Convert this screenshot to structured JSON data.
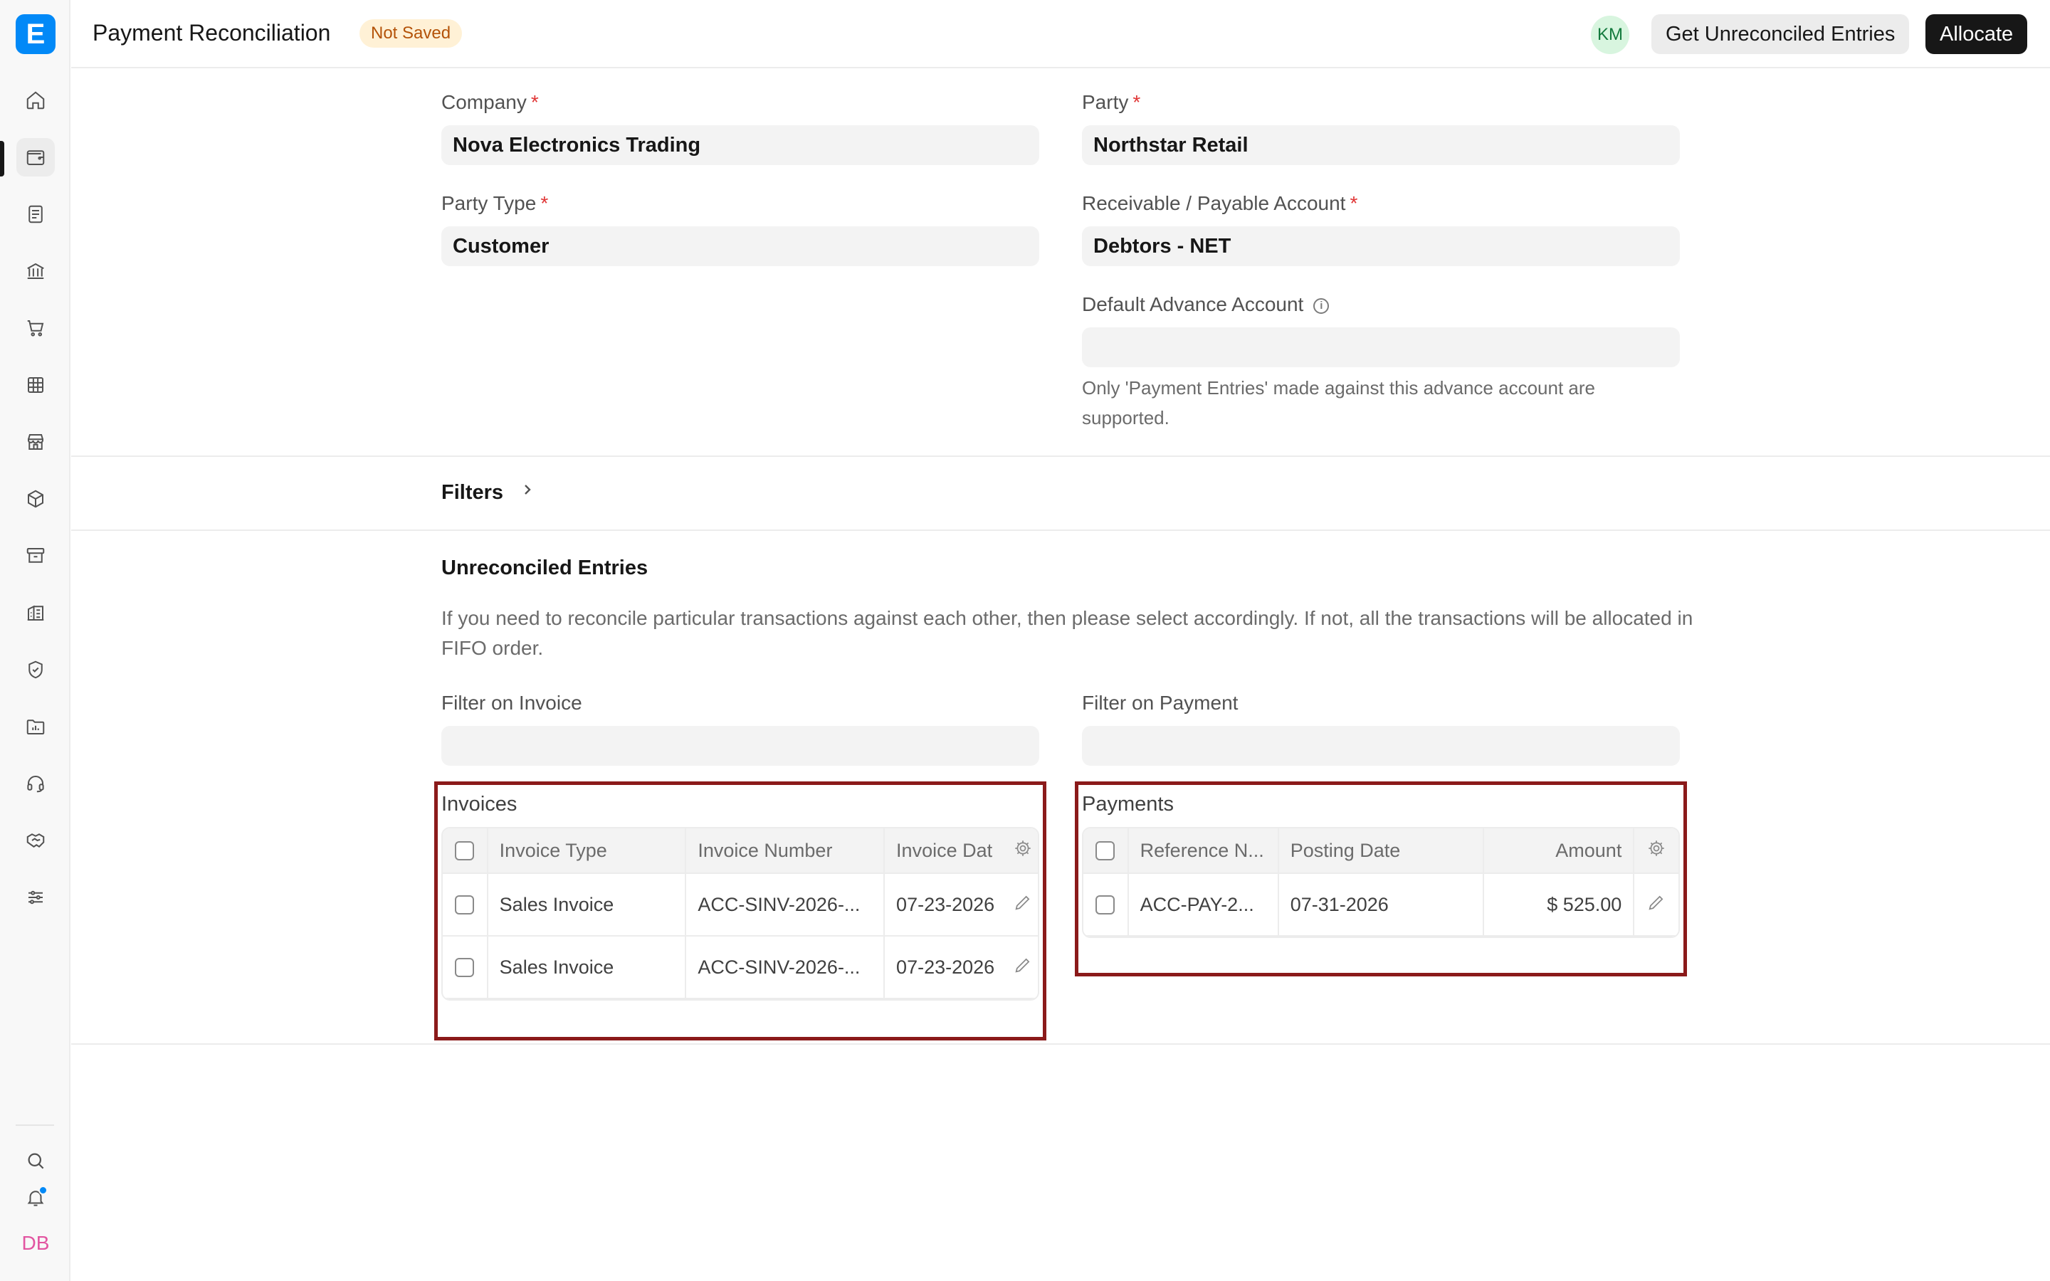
{
  "app": {
    "logo_letter": "E",
    "user_initials": "DB"
  },
  "header": {
    "title": "Payment Reconciliation",
    "status": "Not Saved",
    "user_avatar": "KM",
    "get_entries_label": "Get Unreconciled Entries",
    "allocate_label": "Allocate"
  },
  "sidebar": {
    "items": [
      {
        "name": "home-icon"
      },
      {
        "name": "wallet-icon",
        "active": true
      },
      {
        "name": "document-icon"
      },
      {
        "name": "bank-icon"
      },
      {
        "name": "cart-icon"
      },
      {
        "name": "table-icon"
      },
      {
        "name": "store-icon"
      },
      {
        "name": "box-icon"
      },
      {
        "name": "archive-icon"
      },
      {
        "name": "building-icon"
      },
      {
        "name": "shield-icon"
      },
      {
        "name": "folder-chart-icon"
      },
      {
        "name": "headset-icon"
      },
      {
        "name": "handshake-icon"
      },
      {
        "name": "sliders-icon"
      }
    ],
    "bottom": [
      "search-icon",
      "bell-icon"
    ]
  },
  "form": {
    "company": {
      "label": "Company",
      "value": "Nova Electronics Trading"
    },
    "party": {
      "label": "Party",
      "value": "Northstar Retail"
    },
    "party_type": {
      "label": "Party Type",
      "value": "Customer"
    },
    "receivable_account": {
      "label": "Receivable / Payable Account",
      "value": "Debtors - NET"
    },
    "default_advance_account": {
      "label": "Default Advance Account",
      "value": "",
      "help": "Only 'Payment Entries' made against this advance account are supported."
    }
  },
  "filters": {
    "label": "Filters"
  },
  "unreconciled": {
    "title": "Unreconciled Entries",
    "description": "If you need to reconcile particular transactions against each other, then please select accordingly. If not, all the transactions will be allocated in FIFO order.",
    "filter_invoice": {
      "label": "Filter on Invoice",
      "value": ""
    },
    "filter_payment": {
      "label": "Filter on Payment",
      "value": ""
    }
  },
  "invoices": {
    "title": "Invoices",
    "columns": [
      "Invoice Type",
      "Invoice Number",
      "Invoice Dat"
    ],
    "rows": [
      {
        "type": "Sales Invoice",
        "number": "ACC-SINV-2026-...",
        "date": "07-23-2026"
      },
      {
        "type": "Sales Invoice",
        "number": "ACC-SINV-2026-...",
        "date": "07-23-2026"
      }
    ]
  },
  "payments": {
    "title": "Payments",
    "columns": [
      "Reference N...",
      "Posting Date",
      "Amount"
    ],
    "rows": [
      {
        "reference": "ACC-PAY-2...",
        "posting_date": "07-31-2026",
        "amount": "$ 525.00"
      }
    ]
  },
  "colors": {
    "accent": "#0289f7",
    "highlight": "#8b1a1a",
    "badge_bg": "#fff1d6",
    "badge_text": "#b45309"
  }
}
